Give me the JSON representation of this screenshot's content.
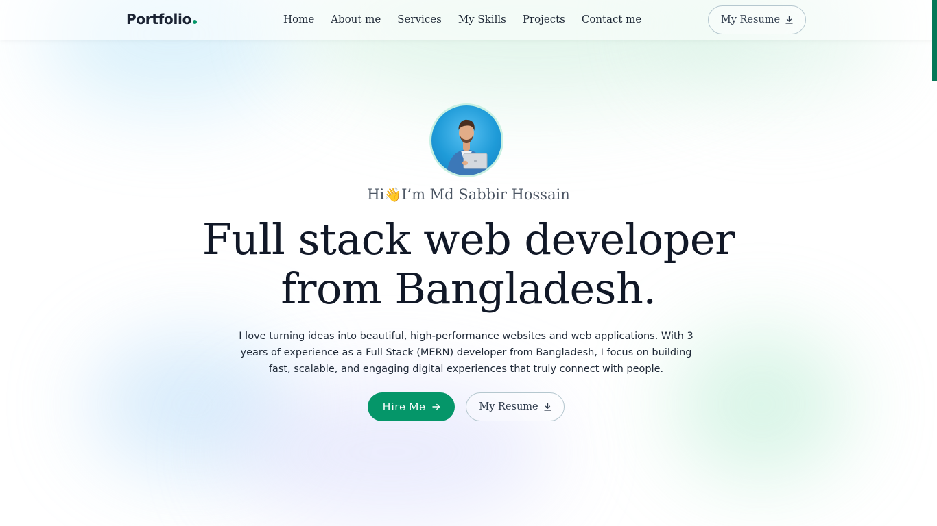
{
  "brand": {
    "logo_text": "Portfolio",
    "accent_color": "#059669"
  },
  "nav": {
    "items": [
      "Home",
      "About me",
      "Services",
      "My Skills",
      "Projects",
      "Contact me"
    ]
  },
  "header": {
    "resume_label": "My Resume",
    "resume_icon": "download-icon"
  },
  "hero": {
    "greeting_prefix": "Hi",
    "greeting_emoji": "👋",
    "greeting_name": "I’m Md Sabbir Hossain",
    "headline_line1": "Full stack web developer",
    "headline_line2": "from Bangladesh.",
    "intro": "I love turning ideas into beautiful, high-performance websites and web applications. With 3 years of experience as a Full Stack (MERN) developer from Bangladesh, I focus on building fast, scalable, and engaging digital experiences that truly connect with people.",
    "primary_button": "Hire Me",
    "primary_icon": "arrow-right-icon",
    "secondary_button": "My Resume",
    "secondary_icon": "download-icon",
    "avatar_alt": "profile-photo"
  }
}
